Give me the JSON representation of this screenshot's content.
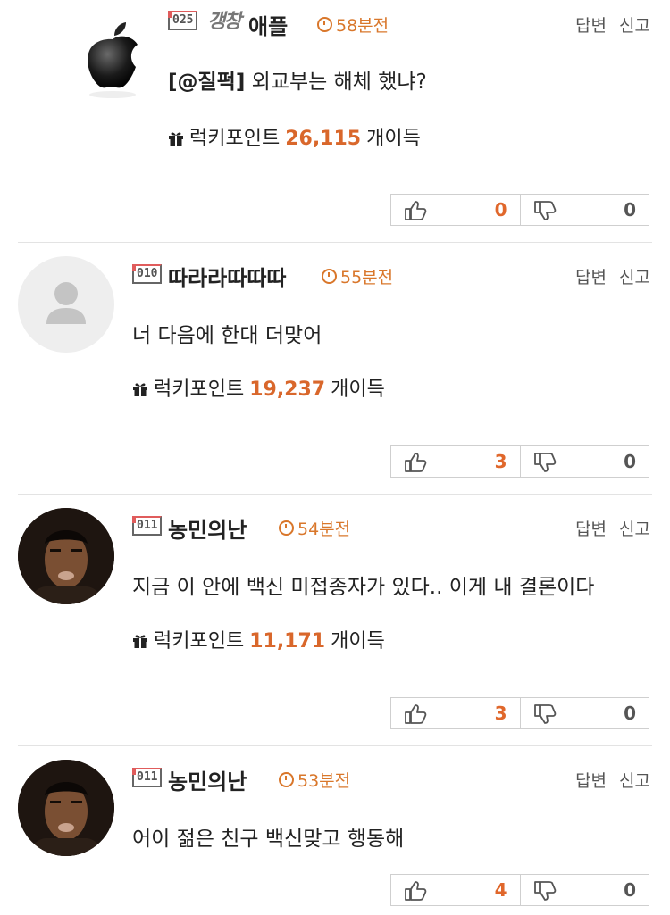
{
  "actions": {
    "reply": "답변",
    "report": "신고"
  },
  "points_label": {
    "prefix": "럭키포인트",
    "suffix": "개이득"
  },
  "comments": [
    {
      "nickname": "애플",
      "badge": "025",
      "badge_image": "갱창",
      "avatar": "apple-logo",
      "time": "58분전",
      "tag": "[@질퍽]",
      "text": "외교부는 해체 했냐?",
      "points": "26,115",
      "likes": "0",
      "dislikes": "0"
    },
    {
      "nickname": "따라라따따따",
      "badge": "010",
      "avatar": "default-user",
      "time": "55분전",
      "text": "너 다음에 한대 더맞어",
      "points": "19,237",
      "likes": "3",
      "dislikes": "0"
    },
    {
      "nickname": "농민의난",
      "badge": "011",
      "avatar": "face-photo",
      "time": "54분전",
      "text": "지금 이 안에 백신 미접종자가 있다.. 이게 내 결론이다",
      "points": "11,171",
      "likes": "3",
      "dislikes": "0"
    },
    {
      "nickname": "농민의난",
      "badge": "011",
      "avatar": "face-photo",
      "time": "53분전",
      "text": "어이 젊은 친구 백신맞고 행동해",
      "likes": "4",
      "dislikes": "0"
    }
  ],
  "colors": {
    "accent": "#d9672b",
    "time": "#d9772b",
    "divider": "#e3e3e3"
  }
}
